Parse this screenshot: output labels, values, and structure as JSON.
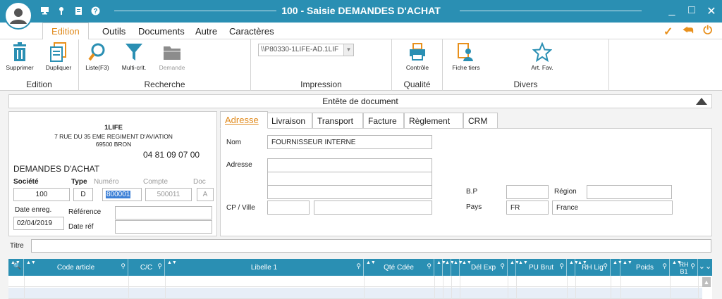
{
  "window": {
    "title": "100 - Saisie DEMANDES D'ACHAT",
    "controls": [
      "minimize-icon",
      "maximize-icon",
      "close-icon"
    ]
  },
  "menu": {
    "items": [
      "Edition",
      "Outils",
      "Documents",
      "Autre",
      "Caractères"
    ],
    "active": "Edition",
    "accent_color": "#e08a1c"
  },
  "ribbon": {
    "groups": [
      {
        "label": "Edition",
        "buttons": [
          {
            "label": "Supprimer",
            "icon": "trash-icon"
          },
          {
            "label": "Dupliquer",
            "icon": "duplicate-icon"
          }
        ]
      },
      {
        "label": "Recherche",
        "buttons": [
          {
            "label": "Liste(F3)",
            "icon": "magnifier-icon"
          },
          {
            "label": "Multi-crit.",
            "icon": "filter-icon"
          },
          {
            "label": "Demande",
            "icon": "folder-icon",
            "disabled": true
          }
        ]
      },
      {
        "label": "Impression",
        "printer": "\\\\P80330-1LIFE-AD.1LIF"
      },
      {
        "label": "Qualité",
        "buttons": [
          {
            "label": "Contrôle",
            "icon": "printer-icon"
          }
        ]
      },
      {
        "label": "Divers",
        "buttons": [
          {
            "label": "Fiche tiers",
            "icon": "contact-card-icon"
          },
          {
            "label": "Art. Fav.",
            "icon": "star-icon"
          }
        ]
      }
    ]
  },
  "section": {
    "title": "Entête de document"
  },
  "company": {
    "name": "1LIFE",
    "address1": "7 RUE DU 35 EME REGIMENT D'AVIATION",
    "address2": "69500 BRON",
    "phone": "04 81 09 07 00",
    "doc_type": "DEMANDES D'ACHAT"
  },
  "doc_fields": {
    "labels": {
      "societe": "Société",
      "type": "Type",
      "numero": "Numéro",
      "compte": "Compte",
      "doc": "Doc",
      "date_enreg": "Date enreg.",
      "reference": "Référence",
      "date_ref": "Date réf"
    },
    "societe": "100",
    "type": "D",
    "numero": "800001",
    "compte": "500011",
    "doc": "A",
    "date_enreg": "02/04/2019",
    "reference": "",
    "date_ref": ""
  },
  "tabs": [
    "Adresse",
    "Livraison",
    "Transport",
    "Facture",
    "Règlement",
    "CRM"
  ],
  "active_tab": "Adresse",
  "address": {
    "labels": {
      "nom": "Nom",
      "adresse": "Adresse",
      "cp_ville": "CP / Ville",
      "bp": "B.P",
      "region": "Région",
      "pays": "Pays"
    },
    "nom": "FOURNISSEUR INTERNE",
    "adresse_lines": [
      "",
      "",
      ""
    ],
    "cp": "",
    "ville": "",
    "bp": "",
    "region": "",
    "pays_code": "FR",
    "pays": "France"
  },
  "titre": {
    "label": "Titre",
    "value": ""
  },
  "grid": {
    "columns": [
      "Code article",
      "C/C",
      "Libelle 1",
      "Qté Cdée",
      "Dél Exp",
      "PU Brut",
      "RH Lig",
      "Poids",
      "RH B1"
    ],
    "header_color": "#2a8fb3",
    "rows": []
  }
}
